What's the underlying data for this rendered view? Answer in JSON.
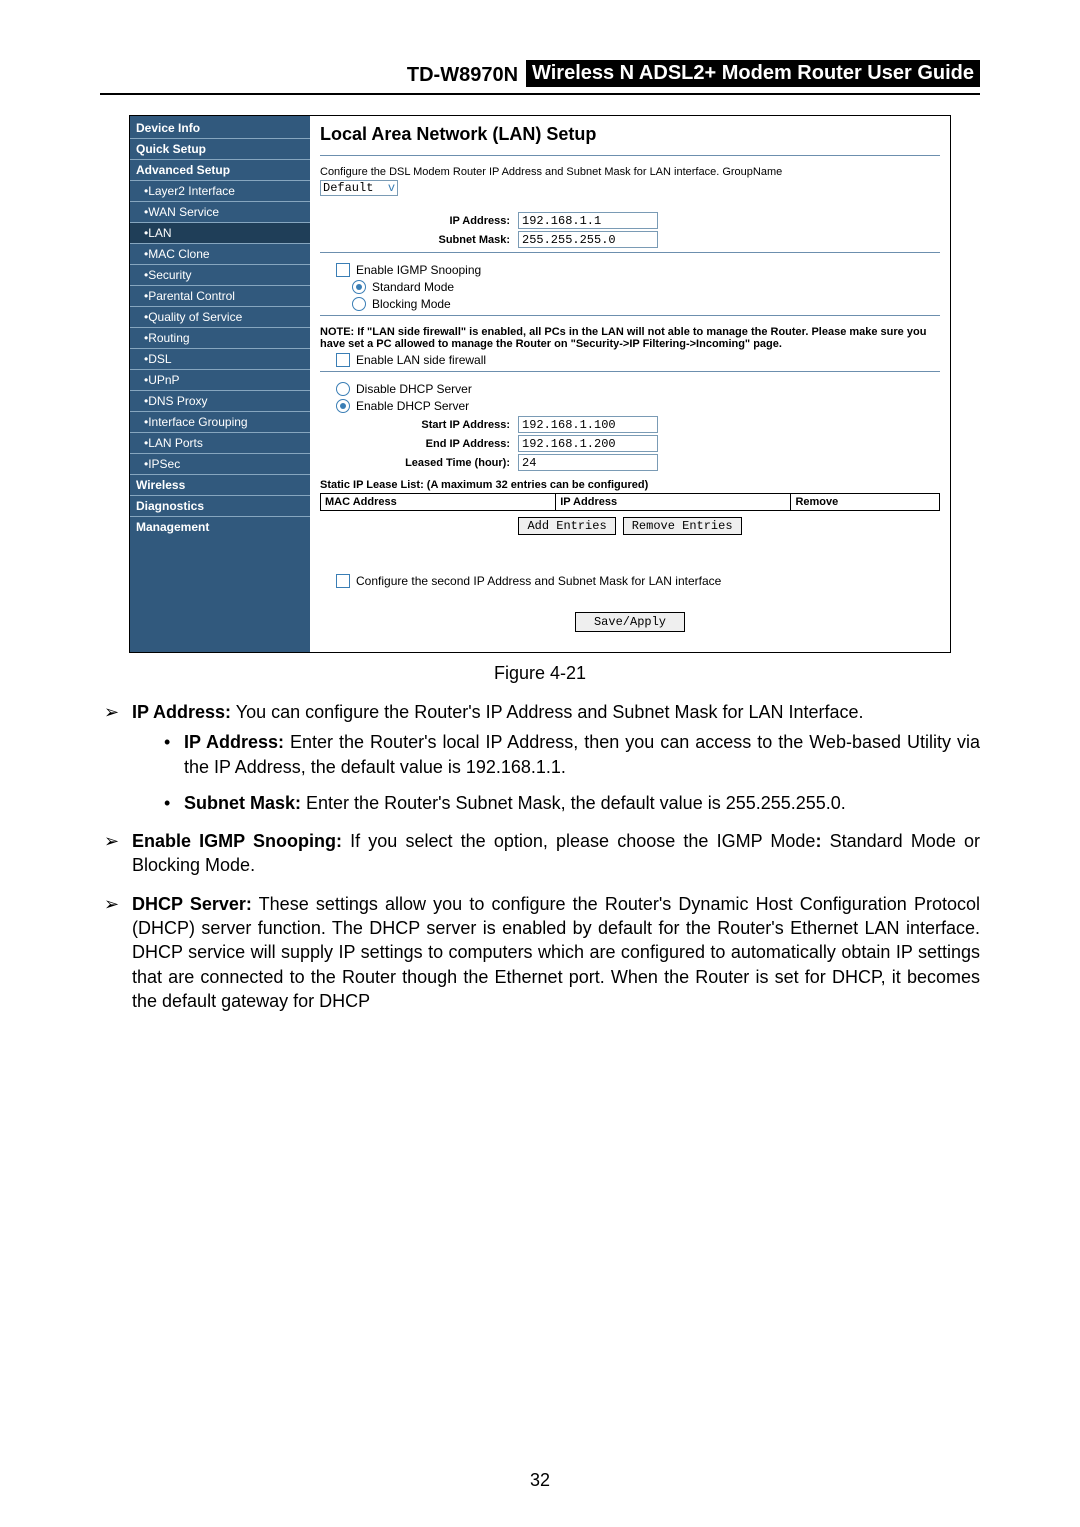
{
  "header": {
    "model": "TD-W8970N",
    "title": "Wireless  N  ADSL2+  Modem  Router  User  Guide"
  },
  "nav": {
    "top": [
      "Device Info",
      "Quick Setup",
      "Advanced Setup"
    ],
    "adv": [
      "Layer2 Interface",
      "WAN Service",
      "LAN",
      "MAC Clone",
      "Security",
      "Parental Control",
      "Quality of Service",
      "Routing",
      "DSL",
      "UPnP",
      "DNS Proxy",
      "Interface Grouping",
      "LAN Ports",
      "IPSec"
    ],
    "bottom": [
      "Wireless",
      "Diagnostics",
      "Management"
    ],
    "selected": "LAN"
  },
  "panel": {
    "title": "Local Area Network (LAN) Setup",
    "intro": "Configure the DSL Modem Router IP Address and Subnet Mask for LAN interface.  GroupName",
    "group_value": "Default",
    "ip_label": "IP Address:",
    "ip_value": "192.168.1.1",
    "mask_label": "Subnet Mask:",
    "mask_value": "255.255.255.0",
    "igmp_label": "Enable IGMP Snooping",
    "mode_std": "Standard Mode",
    "mode_blk": "Blocking Mode",
    "note": "NOTE: If \"LAN side firewall\" is enabled, all PCs in the LAN will not able to manage the Router. Please make sure you have set a PC allowed to manage the Router on \"Security->IP Filtering->Incoming\" page.",
    "fw_label": "Enable LAN side firewall",
    "dhcp_disable": "Disable DHCP Server",
    "dhcp_enable": "Enable DHCP Server",
    "start_label": "Start IP Address:",
    "start_value": "192.168.1.100",
    "end_label": "End IP Address:",
    "end_value": "192.168.1.200",
    "lease_label": "Leased Time (hour):",
    "lease_value": "24",
    "static_title": "Static IP Lease List: (A maximum 32 entries can be configured)",
    "th_mac": "MAC Address",
    "th_ip": "IP Address",
    "th_rm": "Remove",
    "btn_add": "Add Entries",
    "btn_remove": "Remove Entries",
    "second_ip": "Configure the second IP Address and Subnet Mask for LAN interface",
    "btn_save": "Save/Apply"
  },
  "figure_caption": "Figure 4-21",
  "body": {
    "ip_head": "IP Address:",
    "ip_text": " You can configure the Router's IP Address and Subnet Mask for LAN Interface.",
    "ip_sub_head": "IP Address:",
    "ip_sub_text": " Enter the Router's local IP Address, then you can access to the Web-based Utility via the IP Address, the default value is 192.168.1.1.",
    "mask_sub_head": "Subnet Mask:",
    "mask_sub_text": " Enter the Router's Subnet Mask, the default value is 255.255.255.0.",
    "igmp_head": "Enable IGMP Snooping:",
    "igmp_text": " If you select the option, please choose the IGMP Mode",
    "igmp_colon": ":",
    "igmp_tail": " Standard Mode or Blocking Mode.",
    "dhcp_head": "DHCP Server:",
    "dhcp_text": " These settings allow you to configure the Router's Dynamic Host Configuration Protocol (DHCP) server function. The DHCP server is enabled by default for the Router's Ethernet LAN interface. DHCP service will supply IP settings to computers which are configured to automatically obtain IP settings that are connected to the Router though the Ethernet port. When the Router is set for DHCP, it becomes the default gateway for DHCP"
  },
  "page_number": "32"
}
